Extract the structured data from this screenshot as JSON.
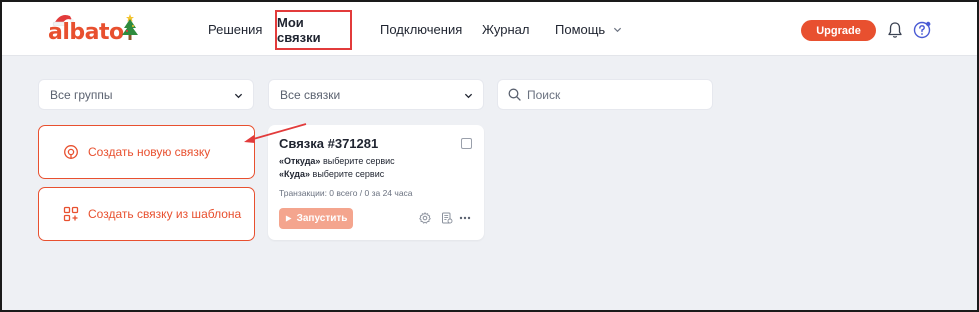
{
  "header": {
    "logo_text": "albato",
    "nav": {
      "solutions": "Решения",
      "my_links": "Мои связки",
      "connections": "Подключения",
      "journal": "Журнал",
      "help": "Помощь"
    },
    "upgrade_label": "Upgrade",
    "icons": {
      "notifications": "bell-icon",
      "help": "help-circle-icon"
    }
  },
  "filters": {
    "groups_value": "Все группы",
    "links_value": "Все связки",
    "search_placeholder": "Поиск"
  },
  "actions": {
    "create_new": "Создать новую связку",
    "create_from_template": "Создать связку из шаблона"
  },
  "link_card": {
    "title": "Связка #371281",
    "from_label": "«Откуда»",
    "from_value": "выберите сервис",
    "to_label": "«Куда»",
    "to_value": "выберите сервис",
    "transactions": "Транзакции: 0 всего / 0 за 24 часа",
    "run_label": "Запустить"
  },
  "colors": {
    "accent": "#e8502f",
    "accent_light": "#f4a58e",
    "highlight": "#e23b3b",
    "background": "#eef0f4"
  }
}
